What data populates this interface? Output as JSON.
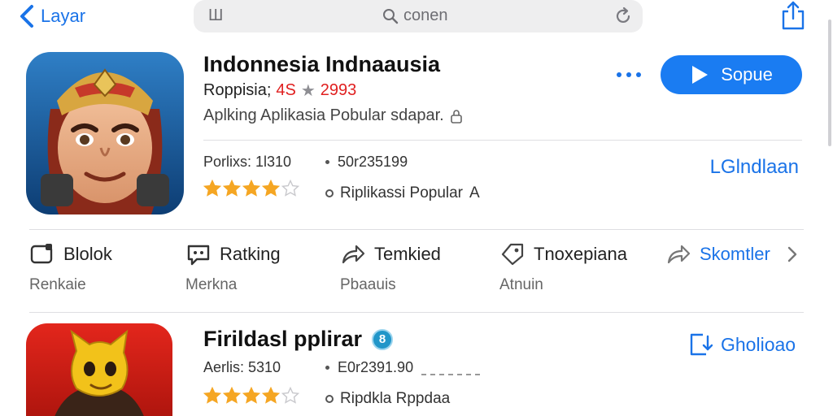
{
  "topbar": {
    "back_label": "Layar",
    "search_left": "Ш",
    "search_query": "conen"
  },
  "featured": {
    "title": "Indonnesia Indnaausia",
    "rating_prefix": "Roppisia;",
    "rating_value": "4S",
    "rating_count": "2993",
    "subtitle": "Aplking Aplikasia Pobular sdapar.",
    "get_label": "Sopue",
    "meta_a": "Porlixs: 1l310",
    "meta_b": "50r235199",
    "tag": "Riplikassi Popular",
    "tag_suffix": "A",
    "right_link": "LGlndlaan",
    "stars_rating": 4
  },
  "actions": [
    {
      "label": "Blolok",
      "sub": "Renkaie"
    },
    {
      "label": "Ratking",
      "sub": "Merkna"
    },
    {
      "label": "Temkied",
      "sub": "Pbaauis"
    },
    {
      "label": "Tnoxepiana",
      "sub": "Atnuin"
    },
    {
      "label": "Skomtler",
      "sub": ""
    }
  ],
  "second": {
    "title": "Firildasl pplirar",
    "badge": "8",
    "meta_a": "Aerlis: 5310",
    "meta_b": "E0r2391.90",
    "tag": "Ripdkla Rppdaa",
    "right_link": "Gholioao",
    "stars_rating": 4
  },
  "colors": {
    "accent": "#1a73e8",
    "button": "#1a7cf2",
    "star": "#f5a623",
    "red": "#e02020"
  }
}
